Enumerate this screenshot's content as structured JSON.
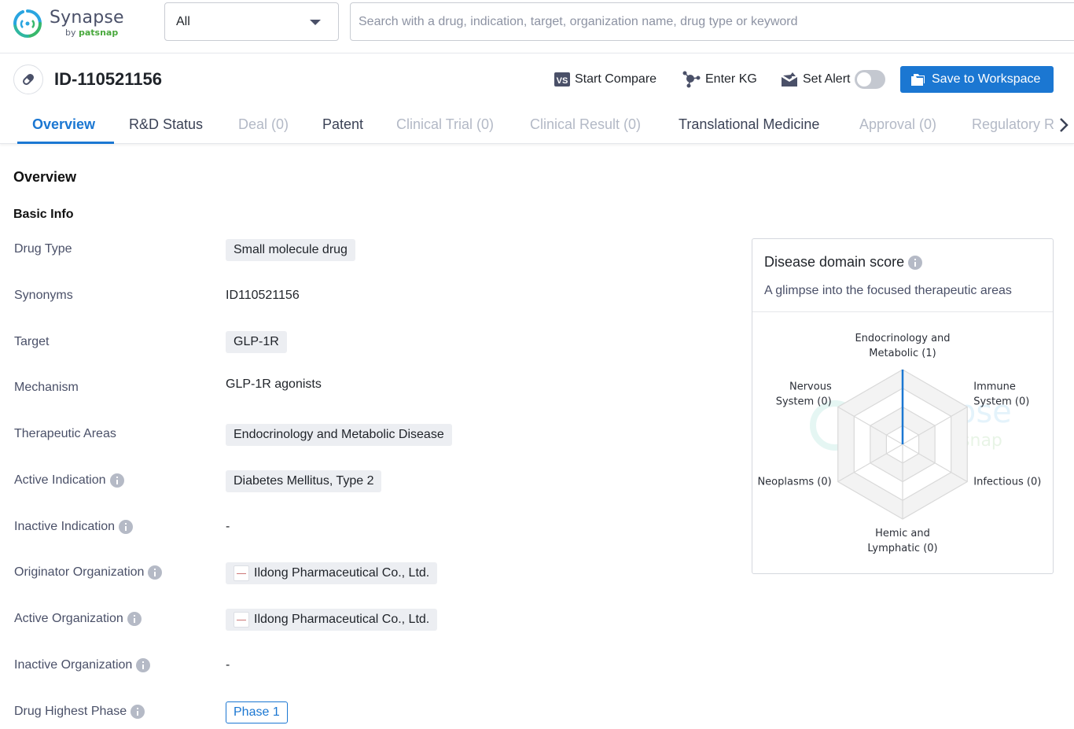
{
  "app": {
    "name": "Synapse",
    "by_prefix": "by",
    "by_brand": "patsnap"
  },
  "search": {
    "scope_value": "All",
    "placeholder": "Search with a drug, indication, target, organization name, drug type or keyword",
    "value": ""
  },
  "header": {
    "drug_id": "ID-110521156",
    "actions": {
      "start_compare": "Start Compare",
      "enter_kg": "Enter KG",
      "set_alert": "Set Alert",
      "set_alert_enabled": false,
      "save_to_workspace": "Save to Workspace"
    }
  },
  "tabs": [
    {
      "label": "Overview",
      "state": "active"
    },
    {
      "label": "R&D Status",
      "state": "normal"
    },
    {
      "label": "Deal (0)",
      "state": "disabled"
    },
    {
      "label": "Patent",
      "state": "normal"
    },
    {
      "label": "Clinical Trial (0)",
      "state": "disabled"
    },
    {
      "label": "Clinical Result (0)",
      "state": "disabled"
    },
    {
      "label": "Translational Medicine",
      "state": "normal"
    },
    {
      "label": "Approval (0)",
      "state": "disabled"
    },
    {
      "label": "Regulatory R",
      "state": "disabled"
    }
  ],
  "overview": {
    "title": "Overview",
    "basic_info_title": "Basic Info",
    "fields": {
      "drug_type": {
        "label": "Drug Type",
        "value": "Small molecule drug"
      },
      "synonyms": {
        "label": "Synonyms",
        "value": "ID110521156"
      },
      "target": {
        "label": "Target",
        "value": "GLP-1R"
      },
      "mechanism": {
        "label": "Mechanism",
        "value": "GLP-1R agonists"
      },
      "therapeutic_areas": {
        "label": "Therapeutic Areas",
        "value": "Endocrinology and Metabolic Disease"
      },
      "active_indication": {
        "label": "Active Indication",
        "value": "Diabetes Mellitus, Type 2"
      },
      "inactive_indication": {
        "label": "Inactive Indication",
        "value": "-"
      },
      "originator_org": {
        "label": "Originator Organization",
        "value": "Ildong Pharmaceutical Co., Ltd."
      },
      "active_org": {
        "label": "Active Organization",
        "value": "Ildong Pharmaceutical Co., Ltd."
      },
      "inactive_org": {
        "label": "Inactive Organization",
        "value": "-"
      },
      "highest_phase": {
        "label": "Drug Highest Phase",
        "value": "Phase 1"
      }
    }
  },
  "disease_card": {
    "title": "Disease domain score",
    "subtitle": "A glimpse into the focused therapeutic areas",
    "axes": [
      {
        "line1": "Endocrinology and",
        "line2": "Metabolic (1)",
        "value": 1
      },
      {
        "line1": "Immune",
        "line2": "System (0)",
        "value": 0
      },
      {
        "line1": "Infectious (0)",
        "line2": "",
        "value": 0
      },
      {
        "line1": "Hemic and",
        "line2": "Lymphatic (0)",
        "value": 0
      },
      {
        "line1": "Neoplasms (0)",
        "line2": "",
        "value": 0
      },
      {
        "line1": "Nervous",
        "line2": "System (0)",
        "value": 0
      }
    ],
    "max": 1,
    "series_color": "#1b77d2"
  },
  "colors": {
    "accent": "#1b77d2",
    "brand_green": "#48a83c"
  }
}
